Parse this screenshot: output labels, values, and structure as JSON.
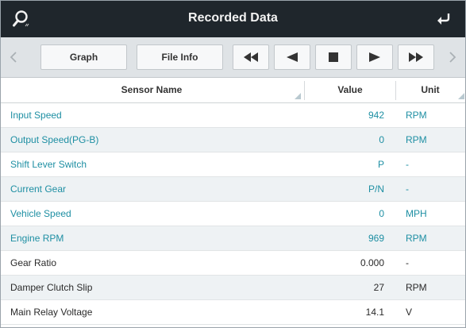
{
  "window": {
    "title": "Recorded Data"
  },
  "icons": {
    "search": "search-icon",
    "back": "back-arrow-icon"
  },
  "toolbar": {
    "graph_label": "Graph",
    "file_info_label": "File Info",
    "controls": [
      "rewind",
      "previous",
      "stop",
      "play",
      "fast-forward"
    ]
  },
  "table": {
    "headers": {
      "sensor_name": "Sensor Name",
      "value": "Value",
      "unit": "Unit"
    },
    "rows": [
      {
        "name": "Input Speed",
        "value": "942",
        "unit": "RPM"
      },
      {
        "name": "Output Speed(PG-B)",
        "value": "0",
        "unit": "RPM"
      },
      {
        "name": "Shift Lever Switch",
        "value": "P",
        "unit": "-"
      },
      {
        "name": "Current Gear",
        "value": "P/N",
        "unit": "-"
      },
      {
        "name": "Vehicle Speed",
        "value": "0",
        "unit": "MPH"
      },
      {
        "name": "Engine RPM",
        "value": "969",
        "unit": "RPM"
      },
      {
        "name": "Gear Ratio",
        "value": "0.000",
        "unit": "-"
      },
      {
        "name": "Damper Clutch Slip",
        "value": "27",
        "unit": "RPM"
      },
      {
        "name": "Main Relay Voltage",
        "value": "14.1",
        "unit": "V"
      }
    ]
  },
  "colors": {
    "titlebar": "#1f262c",
    "teal_text": "#1e8fa3",
    "dark_text": "#2a2a2a",
    "row_alt": "#eef2f4"
  }
}
